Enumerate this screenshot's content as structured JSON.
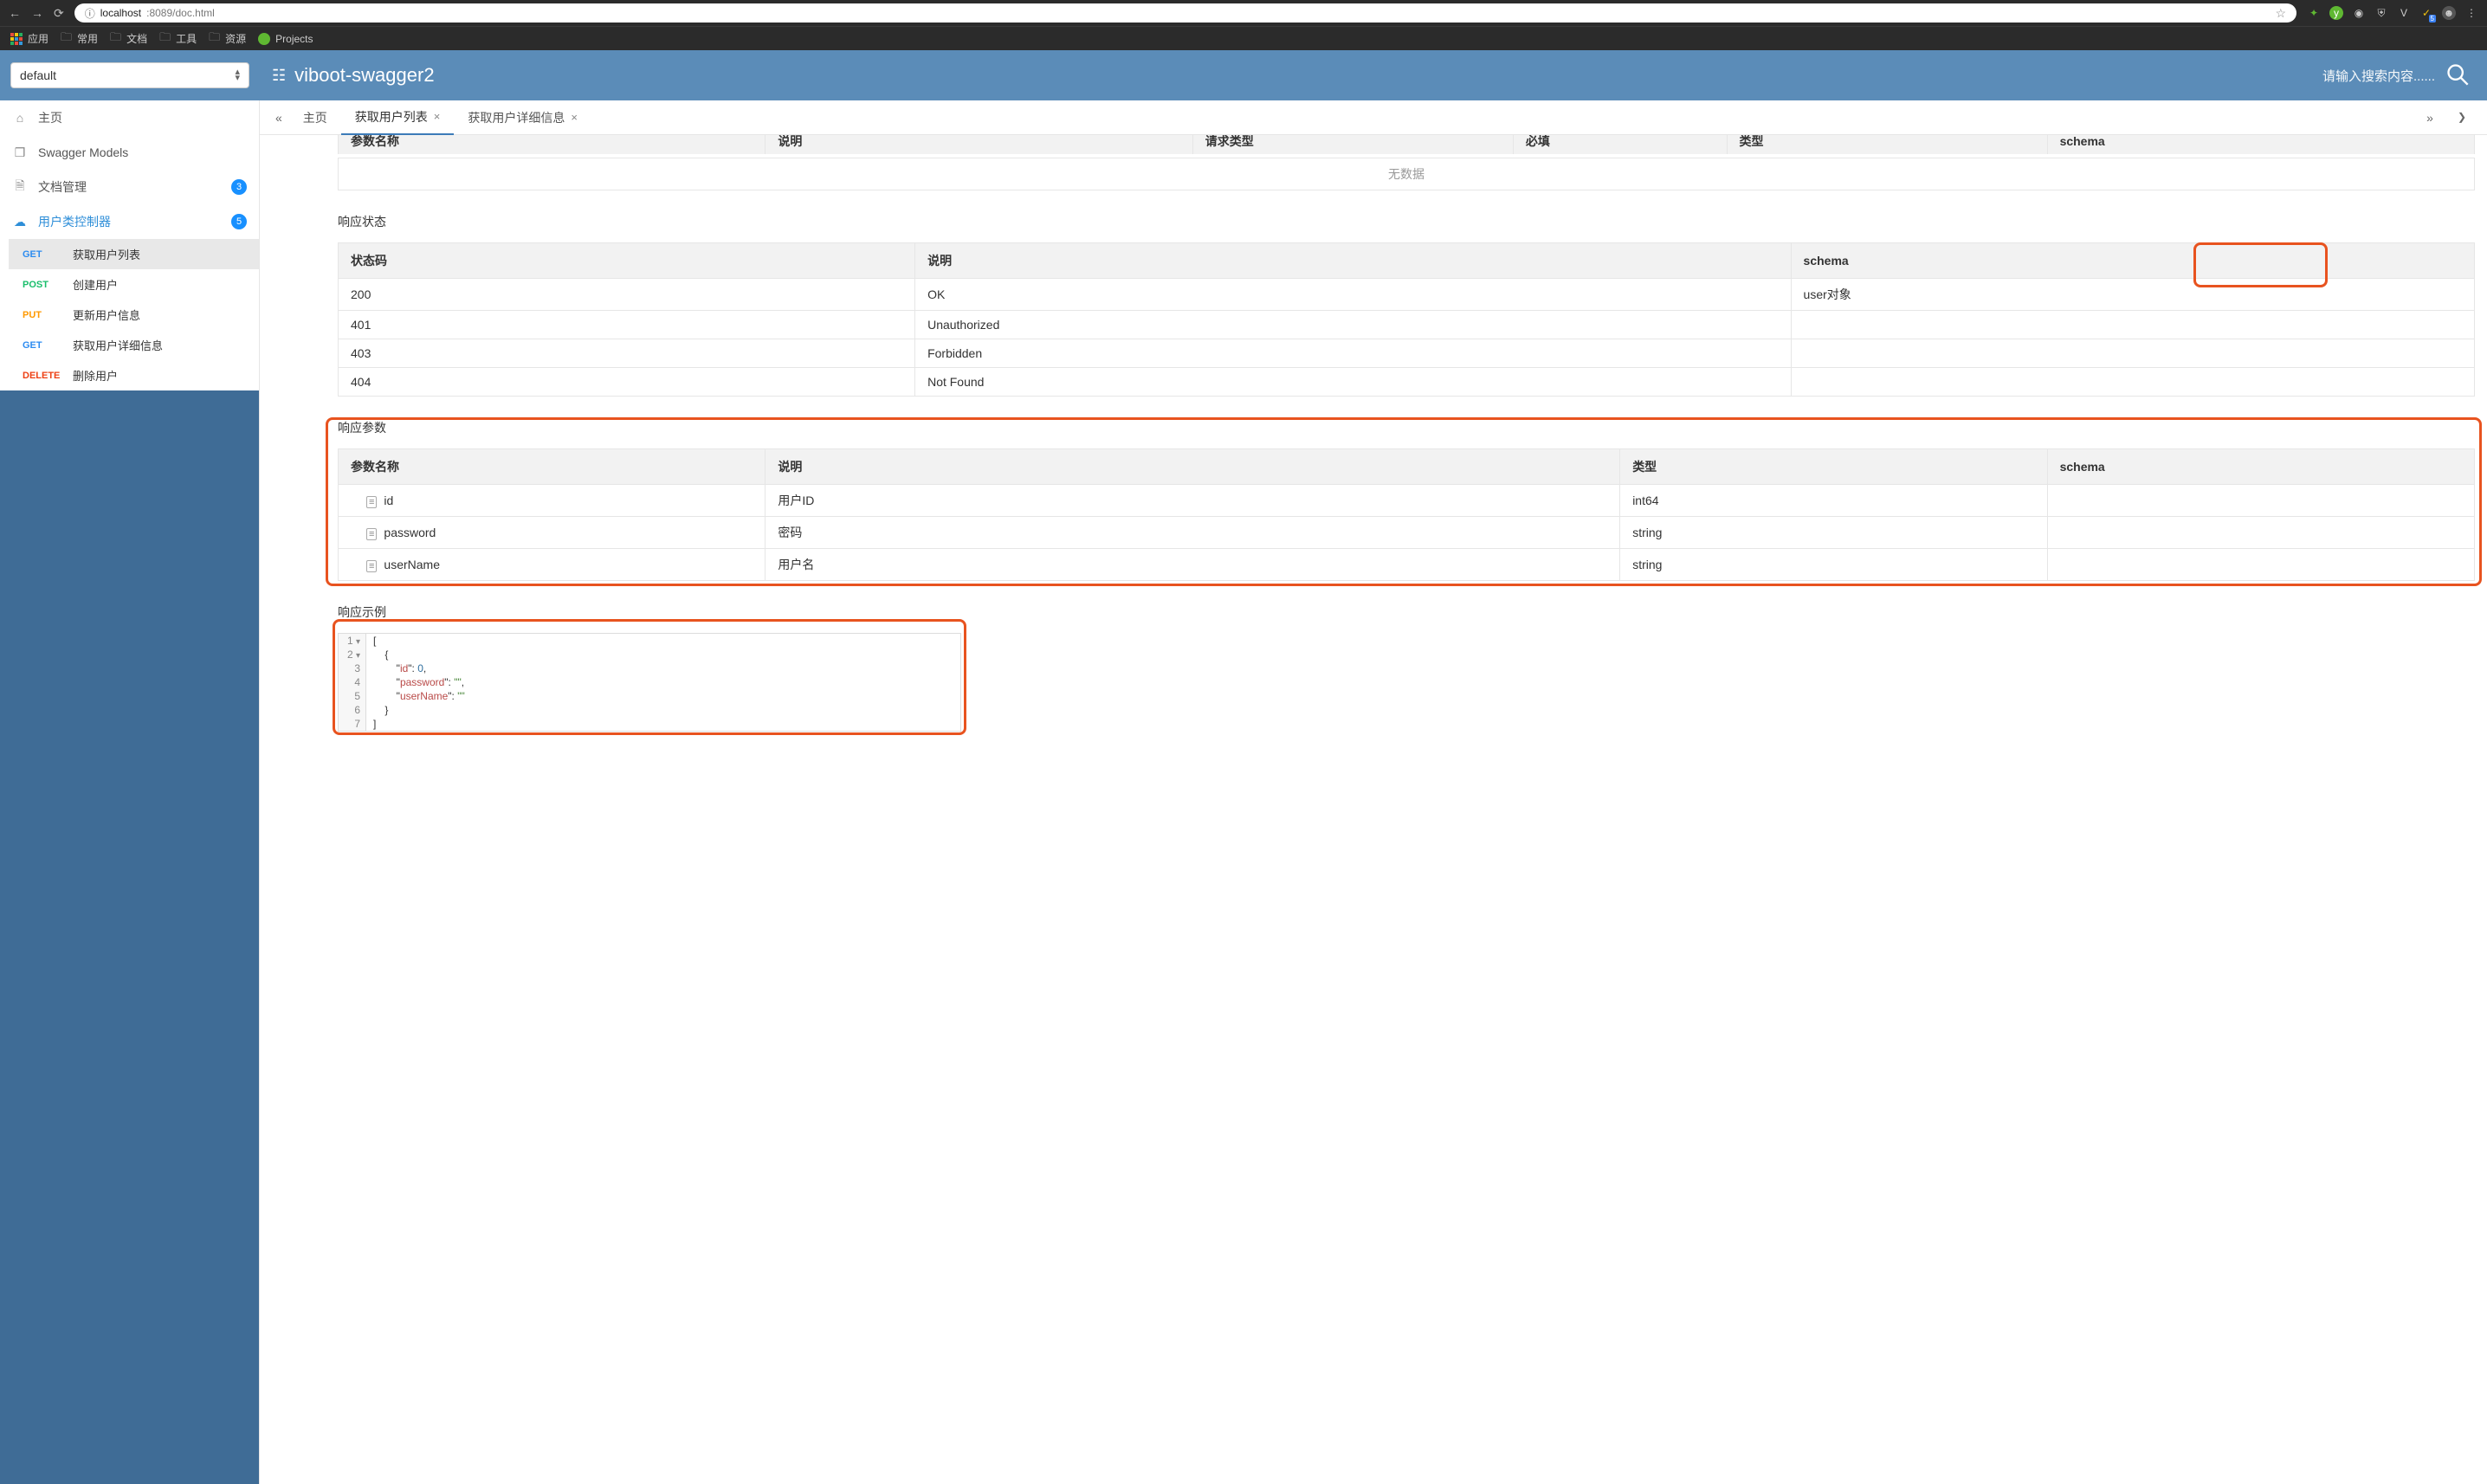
{
  "browser": {
    "url_prefix": "localhost",
    "url_port_path": ":8089/doc.html",
    "info_icon_label": "ⓘ",
    "bookmarks": [
      "应用",
      "常用",
      "文档",
      "工具",
      "资源",
      "Projects"
    ]
  },
  "header": {
    "select_value": "default",
    "title": "viboot-swagger2",
    "search_placeholder": "请输入搜索内容......"
  },
  "sidebar": {
    "home": "主页",
    "swagger_models": "Swagger Models",
    "doc_manage": "文档管理",
    "doc_manage_badge": "3",
    "user_controller": "用户类控制器",
    "user_controller_badge": "5",
    "apis": [
      {
        "method": "GET",
        "label": "获取用户列表",
        "mclass": "m-get"
      },
      {
        "method": "POST",
        "label": "创建用户",
        "mclass": "m-post"
      },
      {
        "method": "PUT",
        "label": "更新用户信息",
        "mclass": "m-put"
      },
      {
        "method": "GET",
        "label": "获取用户详细信息",
        "mclass": "m-get"
      },
      {
        "method": "DELETE",
        "label": "删除用户",
        "mclass": "m-delete"
      }
    ]
  },
  "tabs": {
    "home": "主页",
    "t1": "获取用户列表",
    "t2": "获取用户详细信息"
  },
  "clipped": {
    "c1": "参数名称",
    "c2": "说明",
    "c3": "请求类型",
    "c4": "必填",
    "c5": "类型",
    "c6": "schema",
    "no_data": "无数据"
  },
  "sections": {
    "response_status": "响应状态",
    "response_params": "响应参数",
    "response_example": "响应示例"
  },
  "status_table": {
    "h1": "状态码",
    "h2": "说明",
    "h3": "schema",
    "rows": [
      {
        "code": "200",
        "desc": "OK",
        "schema": "user对象"
      },
      {
        "code": "401",
        "desc": "Unauthorized",
        "schema": ""
      },
      {
        "code": "403",
        "desc": "Forbidden",
        "schema": ""
      },
      {
        "code": "404",
        "desc": "Not Found",
        "schema": ""
      }
    ]
  },
  "params_table": {
    "h1": "参数名称",
    "h2": "说明",
    "h3": "类型",
    "h4": "schema",
    "rows": [
      {
        "name": "id",
        "desc": "用户ID",
        "type": "int64",
        "schema": ""
      },
      {
        "name": "password",
        "desc": "密码",
        "type": "string",
        "schema": ""
      },
      {
        "name": "userName",
        "desc": "用户名",
        "type": "string",
        "schema": ""
      }
    ]
  },
  "code": {
    "l1": "[",
    "l2": "    {",
    "l3a": "        \"",
    "l3k": "id",
    "l3b": "\": ",
    "l3v": "0",
    "l3c": ",",
    "l4a": "        \"",
    "l4k": "password",
    "l4b": "\": ",
    "l4v": "\"\"",
    "l4c": ",",
    "l5a": "        \"",
    "l5k": "userName",
    "l5b": "\": ",
    "l5v": "\"\"",
    "l6": "    }",
    "l7": "]"
  }
}
